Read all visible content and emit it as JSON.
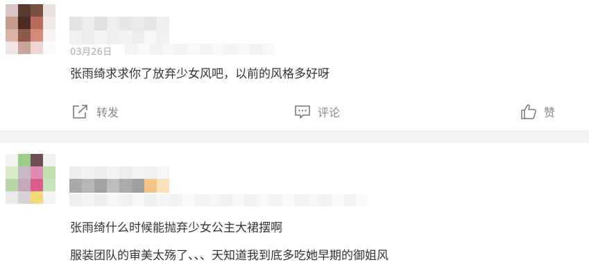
{
  "comments": [
    {
      "meta": "03月26日",
      "lines": [
        "张雨绮求求你了放弃少女风吧，以前的风格多好呀"
      ],
      "actions": {
        "repost": "转发",
        "comment": "评论",
        "like": "赞"
      }
    },
    {
      "lines": [
        "张雨绮什么时候能抛弃少女公主大裙摆啊",
        "服装团队的审美太殇了、、、天知道我到底多吃她早期的御姐风"
      ]
    }
  ]
}
